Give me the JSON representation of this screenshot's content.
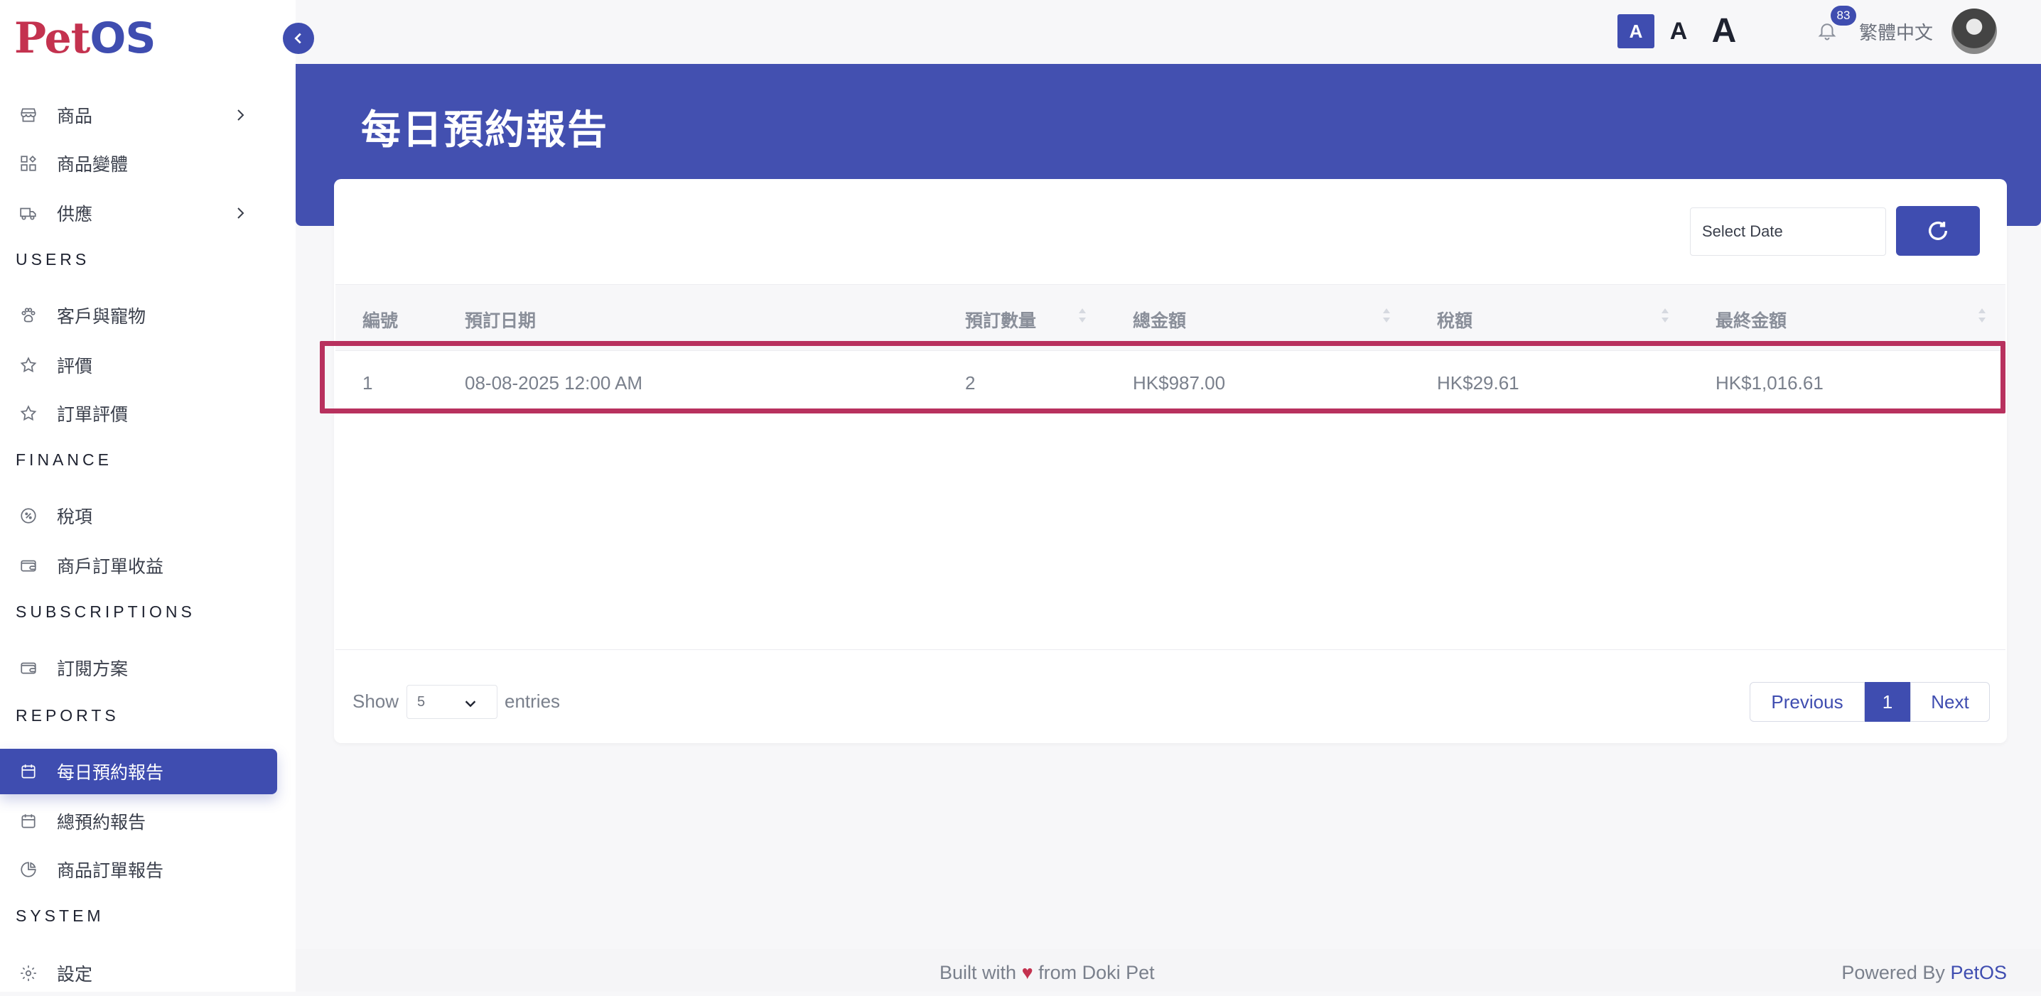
{
  "logo": {
    "part1": "Pet",
    "part2": "OS"
  },
  "header": {
    "font_size_buttons": [
      "A",
      "A",
      "A"
    ],
    "notification_count": "83",
    "language": "繁體中文"
  },
  "sidebar": {
    "items": [
      {
        "label": "商品",
        "icon": "store-icon",
        "has_chevron": true
      },
      {
        "label": "商品變體",
        "icon": "variants-icon",
        "has_chevron": false
      },
      {
        "label": "供應",
        "icon": "truck-icon",
        "has_chevron": true
      }
    ],
    "sections": {
      "users": "USERS",
      "finance": "FINANCE",
      "subscriptions": "SUBSCRIPTIONS",
      "reports": "REPORTS",
      "system": "SYSTEM"
    },
    "users_items": [
      {
        "label": "客戶與寵物",
        "icon": "paw-icon"
      },
      {
        "label": "評價",
        "icon": "star-icon"
      },
      {
        "label": "訂單評價",
        "icon": "star-icon"
      }
    ],
    "finance_items": [
      {
        "label": "稅項",
        "icon": "tax-icon"
      },
      {
        "label": "商戶訂單收益",
        "icon": "wallet-icon"
      }
    ],
    "subscription_items": [
      {
        "label": "訂閱方案",
        "icon": "wallet-icon"
      }
    ],
    "report_items": [
      {
        "label": "每日預約報告",
        "icon": "calendar-icon",
        "active": true
      },
      {
        "label": "總預約報告",
        "icon": "calendar-icon"
      },
      {
        "label": "商品訂單報告",
        "icon": "pie-chart-icon"
      }
    ],
    "system_items": [
      {
        "label": "設定",
        "icon": "gear-icon"
      }
    ]
  },
  "main": {
    "title": "每日預約報告",
    "date_placeholder": "Select Date",
    "table": {
      "columns": [
        "編號",
        "預訂日期",
        "預訂數量",
        "總金額",
        "稅額",
        "最終金額"
      ],
      "rows": [
        [
          "1",
          "08-08-2025 12:00 AM",
          "2",
          "HK$987.00",
          "HK$29.61",
          "HK$1,016.61"
        ]
      ]
    },
    "footer": {
      "show_label": "Show",
      "entries_value": "5",
      "entries_label": "entries",
      "previous": "Previous",
      "page": "1",
      "next": "Next"
    }
  },
  "page_footer": {
    "built_prefix": "Built with",
    "heart": "♥",
    "built_suffix": "from Doki Pet",
    "powered_prefix": "Powered By",
    "powered_brand": "PetOS"
  },
  "colors": {
    "primary": "#3f4db0",
    "highlight": "#b8315e",
    "logo_red": "#c4324f"
  }
}
